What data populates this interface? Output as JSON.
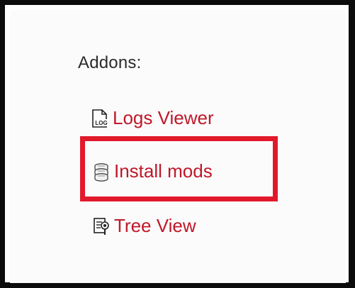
{
  "addons": {
    "heading": "Addons:",
    "items": [
      {
        "label": "Logs Viewer",
        "icon": "log-file-icon",
        "icon_text": "LOG"
      },
      {
        "label": "Install mods",
        "icon": "install-mods-icon"
      },
      {
        "label": "Tree View",
        "icon": "tree-view-icon"
      }
    ]
  },
  "colors": {
    "link": "#c0182a",
    "highlight": "#e2192b",
    "frame": "#0c0c0c",
    "heading": "#2b2b2b"
  }
}
